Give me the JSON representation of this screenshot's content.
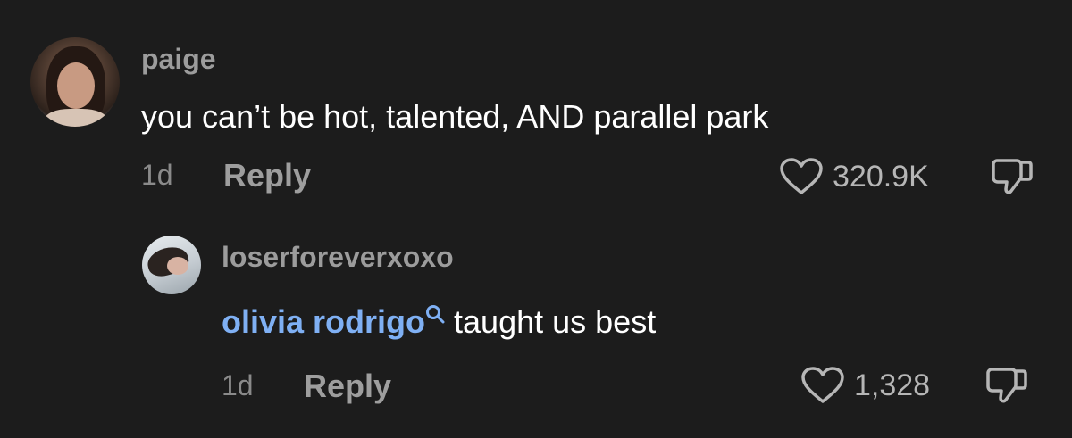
{
  "comments": [
    {
      "username": "paige",
      "text": "you can’t be hot, talented, AND parallel park",
      "time": "1d",
      "reply_label": "Reply",
      "likes": "320.9K"
    }
  ],
  "reply": {
    "username": "loserforeverxoxo",
    "mention": "olivia rodrigo",
    "text": "taught us best",
    "time": "1d",
    "reply_label": "Reply",
    "likes": "1,328"
  },
  "colors": {
    "background": "#1c1c1c",
    "mention": "#7fb0f4",
    "username": "#9c9c9c"
  },
  "icons": [
    "heart-icon",
    "thumbs-down-icon",
    "search-icon"
  ]
}
